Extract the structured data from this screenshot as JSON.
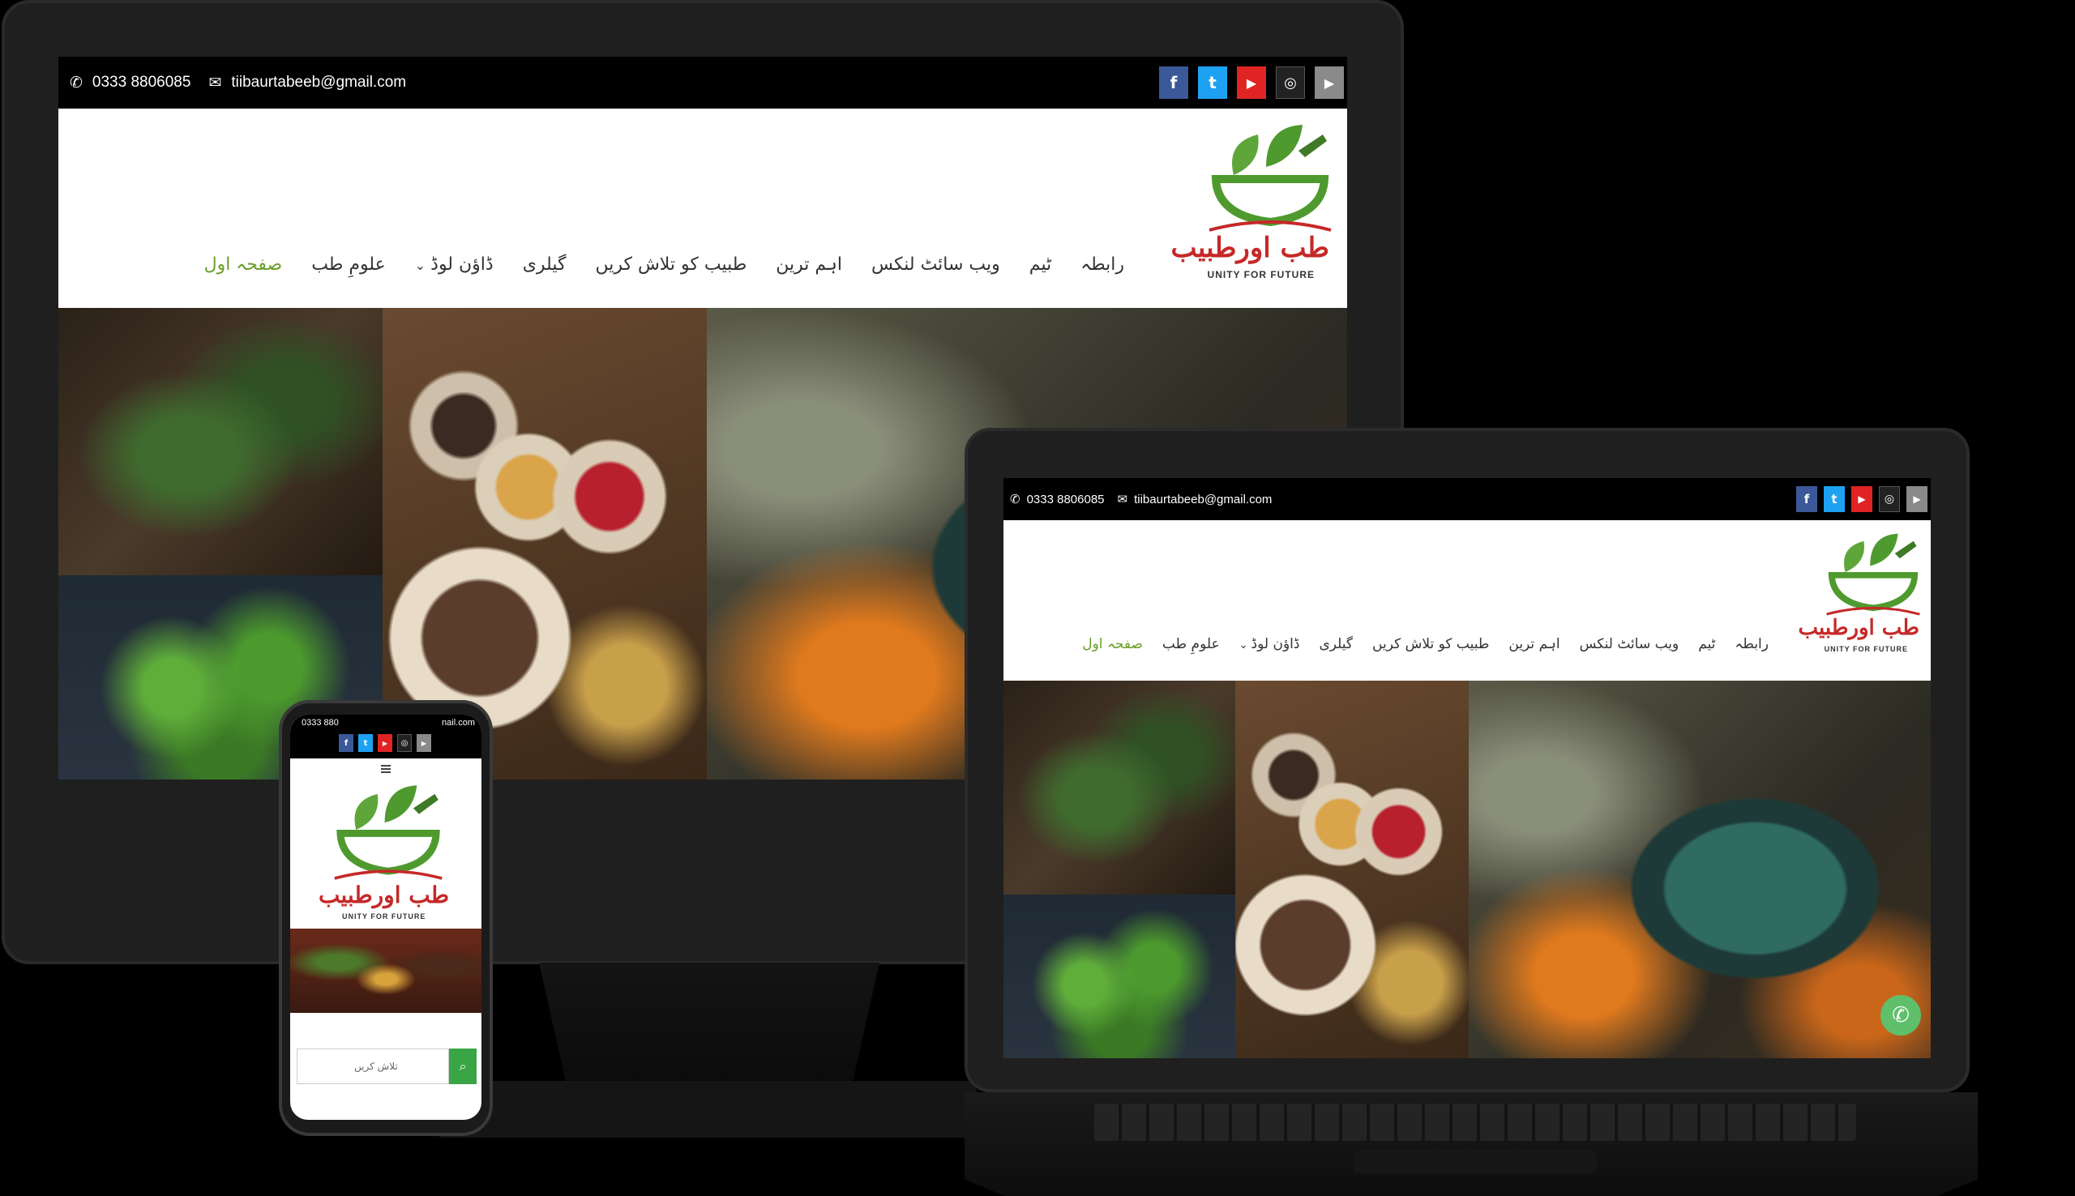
{
  "contact": {
    "phone": "0333 8806085",
    "email": "tiibaurtabeeb@gmail.com",
    "phone_icon": "whatsapp-icon",
    "email_icon": "envelope-icon"
  },
  "social": {
    "facebook": "f",
    "twitter": "t",
    "youtube": "▶",
    "instagram": "◎",
    "play": "▶"
  },
  "logo": {
    "title": "طب اورطبیب",
    "tagline": "Unity for Future"
  },
  "nav": {
    "items": [
      {
        "label": "رابطہ"
      },
      {
        "label": "ٹیم"
      },
      {
        "label": "ویب سائٹ لنکس"
      },
      {
        "label": "اہم ترین"
      },
      {
        "label": "طبیب کو تلاش کریں"
      },
      {
        "label": "گیلری"
      },
      {
        "label": "ڈاؤن لوڈ"
      },
      {
        "label": "علومِ طب"
      },
      {
        "label": "صفحہ اول"
      }
    ],
    "dropdown_caret": "⌄"
  },
  "phone_view": {
    "topbar_left": "0333 880",
    "topbar_right": "nail.com",
    "search_placeholder": "تلاش کریں"
  },
  "colors": {
    "accent_green": "#6a9e2a",
    "logo_red": "#c62828",
    "messenger": "#5fbf6a"
  }
}
